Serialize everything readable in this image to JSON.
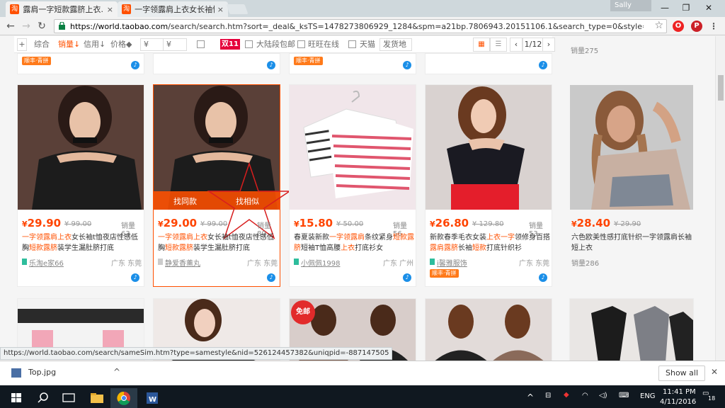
{
  "browser": {
    "tabs": [
      {
        "favicon": "淘",
        "title": "露肩一字短款露脐上衣…",
        "close": "×"
      },
      {
        "favicon": "淘",
        "title": "一字领露肩上衣女长袖性…",
        "close": "×"
      }
    ],
    "profile": "Sally",
    "window_controls": {
      "minimize": "—",
      "restore": "❐",
      "close": "✕"
    },
    "nav": {
      "back": "←",
      "forward": "→",
      "reload": "↻"
    },
    "url_host": "https://world.taobao.com",
    "url_path": "/search/search.htm?sort=_deal&_ksTS=1478273806929_1284&spm=a21bp.7806943.20151106.1&search_type=0&style=grid&json=on&cr",
    "star": "☆"
  },
  "filters": {
    "plus": "+",
    "sort_options": [
      "综合",
      "销量↓",
      "信用↓",
      "价格◆"
    ],
    "price_from": "¥",
    "price_to": "¥",
    "double11": "双11",
    "checkboxes": [
      "大陆段包邮",
      "旺旺在线",
      "天猫"
    ],
    "ship_from": "发货地",
    "page": "1/12",
    "prev": "‹",
    "next": "›"
  },
  "top_row": {
    "badges": [
      "顺丰·青拼",
      "",
      "顺丰·青拼",
      ""
    ],
    "last_sold": "销量275"
  },
  "hover_actions": {
    "same_style": "找同款",
    "similar": "找相似"
  },
  "products": [
    {
      "price": "29.90",
      "orig": "99.00",
      "sold": "销量63",
      "title_parts": [
        [
          "一字领",
          "hl"
        ],
        [
          "露肩",
          "hl"
        ],
        [
          "上衣",
          "hl"
        ],
        [
          "女长袖t恤夜店性感低胸",
          ""
        ],
        [
          "短款",
          "hl"
        ],
        [
          "露脐",
          "hl"
        ],
        [
          "装学生漏肚脐打底",
          ""
        ]
      ],
      "shop": "乐淘e家66",
      "loc": "广东 东莞",
      "badge": ""
    },
    {
      "price": "29.00",
      "orig": "99.00",
      "sold": "销量80",
      "title_parts": [
        [
          "一字领",
          "hl"
        ],
        [
          "露肩",
          "hl"
        ],
        [
          "上衣",
          "hl"
        ],
        [
          "女长袖t恤夜店性感低胸",
          ""
        ],
        [
          "短款",
          "hl"
        ],
        [
          "露脐",
          "hl"
        ],
        [
          "装学生漏肚脐打底",
          ""
        ]
      ],
      "shop": "静爱香薰丸",
      "loc": "广东 东莞",
      "badge": ""
    },
    {
      "price": "15.80",
      "orig": "50.00",
      "sold": "销量56",
      "title_parts": [
        [
          "春夏装新款",
          ""
        ],
        [
          "一字领",
          "hl"
        ],
        [
          "露肩",
          "hl"
        ],
        [
          "条纹紧身",
          ""
        ],
        [
          "短款露脐",
          "hl"
        ],
        [
          "短袖T恤高腰",
          ""
        ],
        [
          "上衣",
          "hl"
        ],
        [
          "打底衫女",
          ""
        ]
      ],
      "shop": "小佩佩1998",
      "loc": "广东 广州",
      "badge": ""
    },
    {
      "price": "26.80",
      "orig": "129.80",
      "sold": "销量53",
      "title_parts": [
        [
          "新款春季毛衣女装",
          ""
        ],
        [
          "上衣",
          "hl"
        ],
        [
          "一字",
          "hl"
        ],
        [
          "领修身百搭",
          ""
        ],
        [
          "露肩",
          "hl"
        ],
        [
          "露脐",
          "hl"
        ],
        [
          "长袖",
          ""
        ],
        [
          "短款",
          "hl"
        ],
        [
          "打底针织衫",
          ""
        ]
      ],
      "shop": "i馨雅服饰",
      "loc": "广东 东莞",
      "badge": "顺丰·青拼"
    },
    {
      "price": "28.40",
      "orig": "29.90",
      "sold": "销量286",
      "title_parts": [
        [
          "六色欧美性感打底针织一字领露肩长袖短上衣",
          ""
        ]
      ],
      "shop": "",
      "loc": "",
      "badge": ""
    }
  ],
  "bottom_row": {
    "freeship": "免邮"
  },
  "status_url": "https://world.taobao.com/search/sameSim.htm?type=samestyle&nid=526124457382&uniqpid=-887147505",
  "download": {
    "file": "Top.jpg",
    "show_all": "Show all",
    "chevron": "^",
    "close": "✕"
  },
  "taskbar": {
    "time": "11:41 PM",
    "date": "4/11/2016",
    "lang": "ENG",
    "notifications": "18"
  },
  "colors": {
    "accent": "#ff5000",
    "price": "#ff4400"
  }
}
